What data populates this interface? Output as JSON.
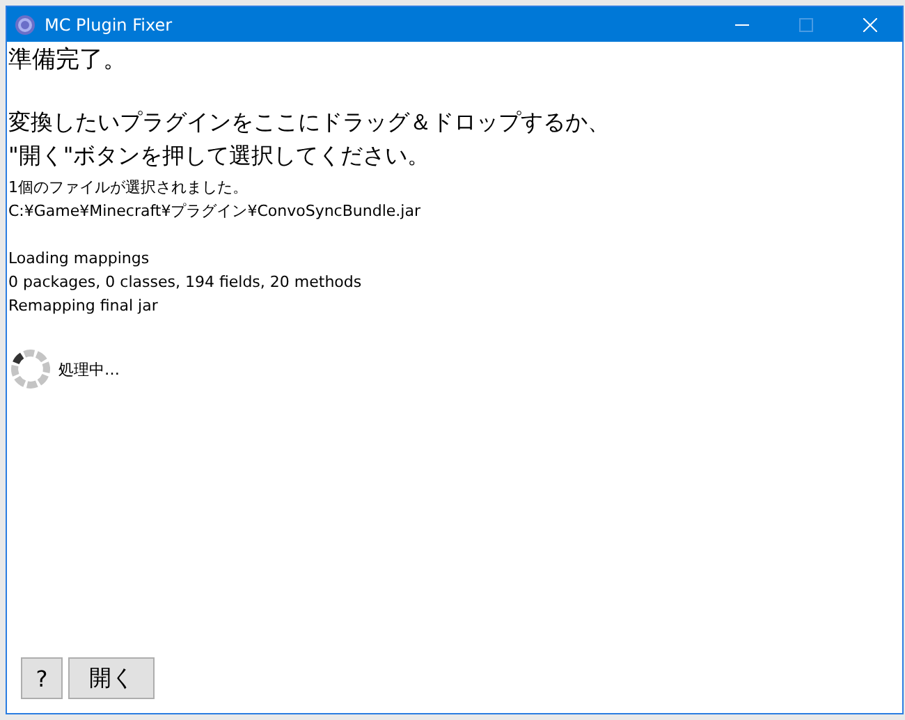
{
  "window": {
    "title": "MC Plugin Fixer",
    "controls": [
      {
        "kind": "minimize",
        "disabled": false
      },
      {
        "kind": "maximize",
        "disabled": true
      },
      {
        "kind": "close",
        "disabled": false
      }
    ]
  },
  "status": "準備完了。",
  "instructions": [
    "変換したいプラグインをここにドラッグ＆ドロップするか、",
    "\"開く\"ボタンを押して選択してください。"
  ],
  "log_groups": [
    [
      "1個のファイルが選択されました。",
      "C:¥Game¥Minecraft¥プラグイン¥ConvoSyncBundle.jar"
    ],
    [
      "Loading mappings",
      "0 packages, 0 classes, 194 fields, 20 methods",
      "Remapping final jar"
    ]
  ],
  "progress": {
    "busy": true,
    "label": "処理中…"
  },
  "buttons": [
    {
      "kind": "help",
      "label": "?"
    },
    {
      "kind": "open",
      "label": "開く"
    }
  ]
}
